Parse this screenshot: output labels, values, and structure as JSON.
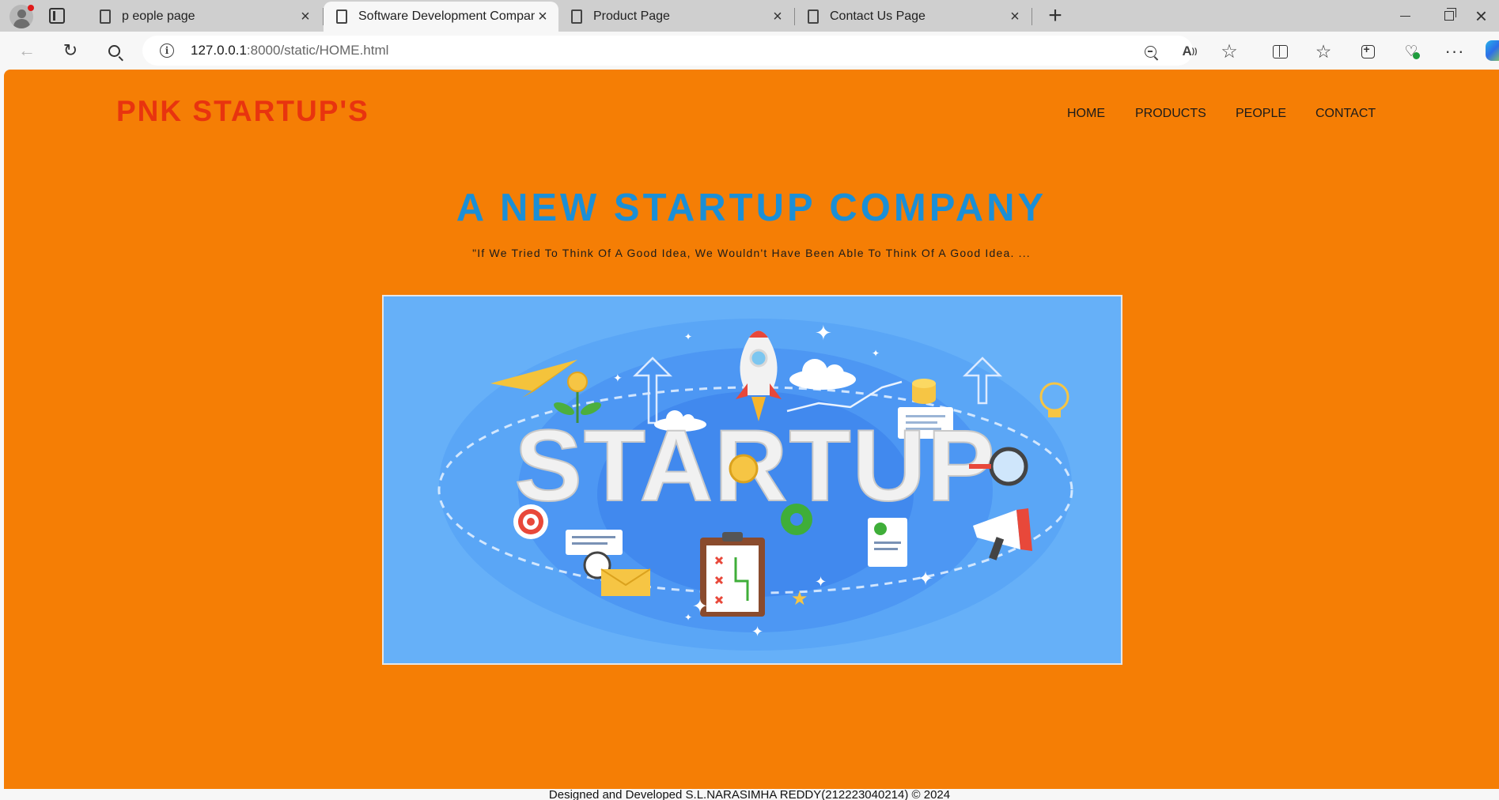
{
  "browser": {
    "tabs": [
      {
        "title": "p eople page",
        "active": false
      },
      {
        "title": "Software Development Company",
        "active": true
      },
      {
        "title": "Product Page",
        "active": false
      },
      {
        "title": "Contact Us Page",
        "active": false
      }
    ],
    "address": {
      "host": "127.0.0.1",
      "path": ":8000/static/HOME.html"
    },
    "icons": [
      "profile-icon",
      "tab-actions-icon",
      "page-icon",
      "close-icon",
      "new-tab-icon",
      "minimize-icon",
      "restore-icon",
      "back-icon",
      "reload-icon",
      "search-icon",
      "info-icon",
      "zoom-out-icon",
      "read-aloud-icon",
      "favorite-star-icon",
      "split-screen-icon",
      "favorites-icon",
      "collections-icon",
      "browser-essentials-icon",
      "more-icon",
      "copilot-icon"
    ]
  },
  "site": {
    "brand": "PNK STARTUP'S",
    "nav": {
      "home": "HOME",
      "products": "PRODUCTS",
      "people": "PEOPLE",
      "contact": "CONTACT"
    },
    "headline": "A NEW STARTUP COMPANY",
    "quote": "\"If We Tried To Think Of A Good Idea, We Wouldn't Have Been Able To Think Of A Good Idea. ...",
    "hero_word": "STARTUP",
    "footer": "Designed and Developed S.L.NARASIMHA REDDY(212223040214) © 2024"
  },
  "colors": {
    "page_background": "#f57e05",
    "brand": "#e8340f",
    "headline": "#1b8fd6",
    "hero_background": "#66b0f8"
  }
}
